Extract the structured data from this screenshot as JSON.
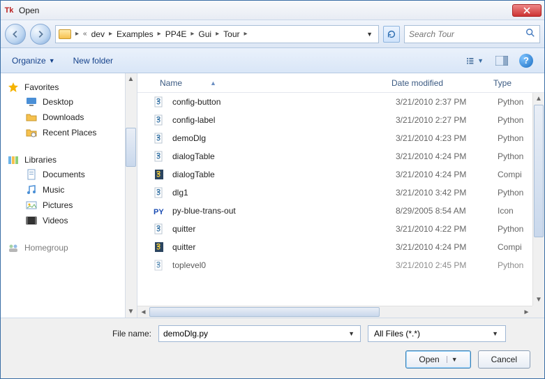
{
  "window": {
    "title": "Open"
  },
  "breadcrumb": {
    "seg0": "dev",
    "seg1": "Examples",
    "seg2": "PP4E",
    "seg3": "Gui",
    "seg4": "Tour"
  },
  "search": {
    "placeholder": "Search Tour"
  },
  "toolbar": {
    "organize": "Organize",
    "newfolder": "New folder"
  },
  "sidebar": {
    "favorites": "Favorites",
    "desktop": "Desktop",
    "downloads": "Downloads",
    "recent": "Recent Places",
    "libraries": "Libraries",
    "documents": "Documents",
    "music": "Music",
    "pictures": "Pictures",
    "videos": "Videos",
    "homegroup": "Homegroup"
  },
  "columns": {
    "name": "Name",
    "date": "Date modified",
    "type": "Type"
  },
  "files": [
    {
      "name": "config-button",
      "date": "3/21/2010 2:37 PM",
      "type": "Python",
      "icon": "py"
    },
    {
      "name": "config-label",
      "date": "3/21/2010 2:27 PM",
      "type": "Python",
      "icon": "py"
    },
    {
      "name": "demoDlg",
      "date": "3/21/2010 4:23 PM",
      "type": "Python",
      "icon": "py"
    },
    {
      "name": "dialogTable",
      "date": "3/21/2010 4:24 PM",
      "type": "Python",
      "icon": "py"
    },
    {
      "name": "dialogTable",
      "date": "3/21/2010 4:24 PM",
      "type": "Compi",
      "icon": "pyc"
    },
    {
      "name": "dlg1",
      "date": "3/21/2010 3:42 PM",
      "type": "Python",
      "icon": "py"
    },
    {
      "name": "py-blue-trans-out",
      "date": "8/29/2005 8:54 AM",
      "type": "Icon",
      "icon": "ico"
    },
    {
      "name": "quitter",
      "date": "3/21/2010 4:22 PM",
      "type": "Python",
      "icon": "py"
    },
    {
      "name": "quitter",
      "date": "3/21/2010 4:24 PM",
      "type": "Compi",
      "icon": "pyc"
    },
    {
      "name": "toplevel0",
      "date": "3/21/2010 2:45 PM",
      "type": "Python",
      "icon": "py"
    }
  ],
  "footer": {
    "filename_label": "File name:",
    "filename_value": "demoDlg.py",
    "filter": "All Files (*.*)",
    "open": "Open",
    "cancel": "Cancel"
  }
}
